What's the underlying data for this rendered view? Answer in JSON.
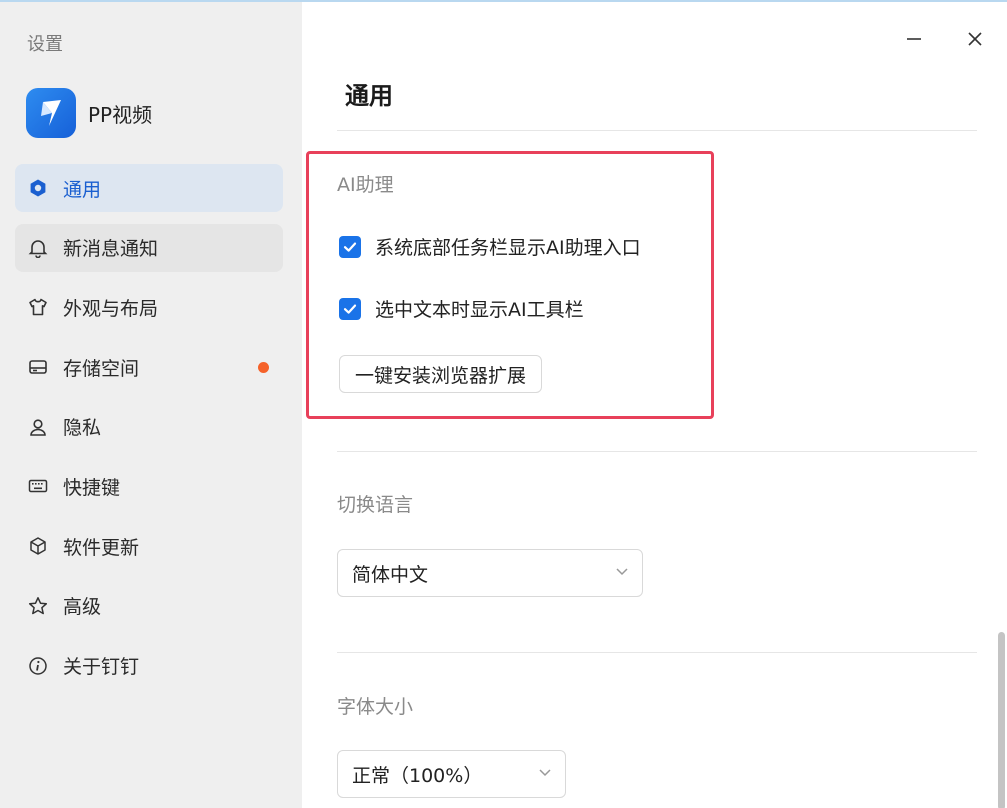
{
  "window": {
    "title": "设置"
  },
  "app": {
    "name": "PP视频"
  },
  "sidebar": {
    "items": [
      {
        "label": "通用",
        "icon": "gear-icon"
      },
      {
        "label": "新消息通知",
        "icon": "bell-icon"
      },
      {
        "label": "外观与布局",
        "icon": "shirt-icon"
      },
      {
        "label": "存储空间",
        "icon": "drive-icon"
      },
      {
        "label": "隐私",
        "icon": "user-icon"
      },
      {
        "label": "快捷键",
        "icon": "keyboard-icon"
      },
      {
        "label": "软件更新",
        "icon": "cube-icon"
      },
      {
        "label": "高级",
        "icon": "star-icon"
      },
      {
        "label": "关于钉钉",
        "icon": "info-icon"
      }
    ]
  },
  "main": {
    "title": "通用",
    "ai": {
      "title": "AI助理",
      "option1": "系统底部任务栏显示AI助理入口",
      "option2": "选中文本时显示AI工具栏",
      "install_button": "一键安装浏览器扩展"
    },
    "language": {
      "title": "切换语言",
      "value": "简体中文"
    },
    "font": {
      "title": "字体大小",
      "value": "正常（100%）"
    }
  },
  "colors": {
    "accent": "#1a73e8",
    "highlight": "#e8405a",
    "badge": "#f5622a",
    "sidebar_bg": "#efefef"
  }
}
